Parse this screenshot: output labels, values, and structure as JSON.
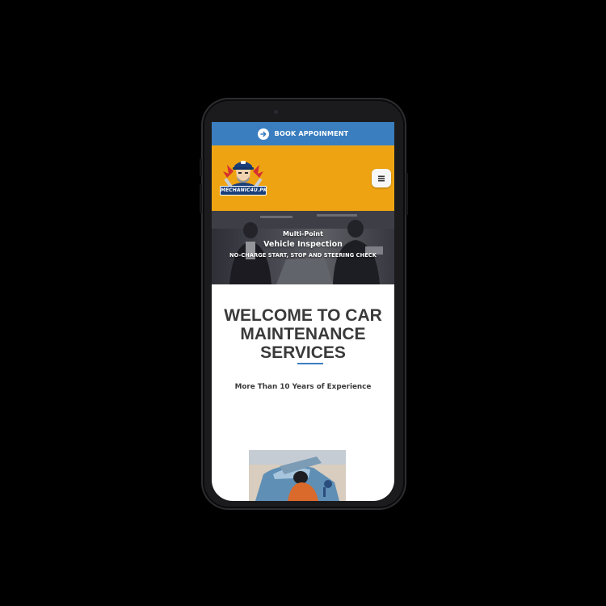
{
  "topbar": {
    "cta_label": "BOOK APPOINMENT",
    "icon": "arrow-right-circle-icon",
    "color": "#3a7ec0"
  },
  "header": {
    "background": "#eea412",
    "logo": {
      "text": "MECHANIC4U.PK",
      "icon": "mechanic-mascot-logo"
    },
    "menu_icon": "hamburger-menu-icon"
  },
  "hero": {
    "kicker": "Multi-Point",
    "title": "Vehicle Inspection",
    "subtitle": "NO-CHARGE START, STOP AND STEERING CHECK"
  },
  "welcome": {
    "line1": "WELCOME TO CAR",
    "line2": "MAINTENANCE",
    "line3": "SERVICES",
    "accent_color": "#3a7ec0",
    "tagline": "More Than 10 Years of Experience"
  }
}
